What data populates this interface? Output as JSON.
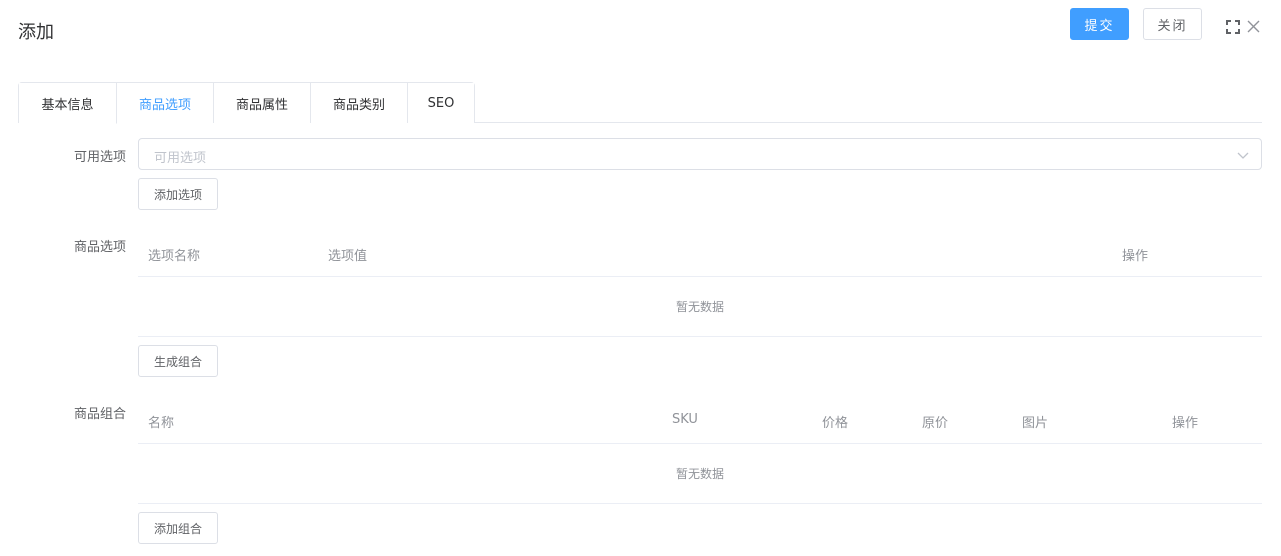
{
  "dialog": {
    "title": "添加",
    "submit_label": "提交",
    "close_label": "关闭"
  },
  "tabs": [
    {
      "label": "基本信息"
    },
    {
      "label": "商品选项",
      "active": true
    },
    {
      "label": "商品属性"
    },
    {
      "label": "商品类别"
    },
    {
      "label": "SEO"
    }
  ],
  "available_options": {
    "label": "可用选项",
    "placeholder": "可用选项",
    "add_button": "添加选项"
  },
  "product_options": {
    "label": "商品选项",
    "columns": [
      "选项名称",
      "选项值",
      "操作"
    ],
    "empty_text": "暂无数据",
    "generate_button": "生成组合"
  },
  "product_combinations": {
    "label": "商品组合",
    "columns": [
      "名称",
      "SKU",
      "价格",
      "原价",
      "图片",
      "操作"
    ],
    "empty_text": "暂无数据",
    "add_button": "添加组合"
  }
}
